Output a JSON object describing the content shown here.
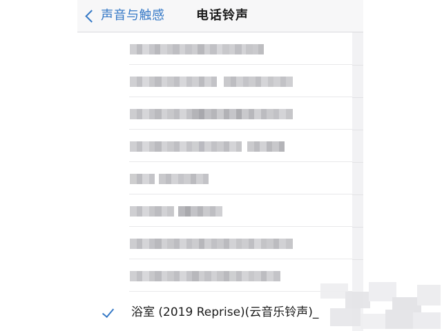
{
  "navbar": {
    "back_label": "声音与触感",
    "title": "电话铃声"
  },
  "list": {
    "rows": [
      {
        "label": "blurred-ringtone-1",
        "segments": [
          [
            "#cfcfd2",
            10
          ],
          [
            "#bdbdc1",
            8
          ],
          [
            "#d8d8db",
            10
          ],
          [
            "#c6c6ca",
            8
          ],
          [
            "#b9b9bd",
            8
          ],
          [
            "#d3d3d6",
            10
          ],
          [
            "#c9c9cc",
            8
          ],
          [
            "#bebec2",
            10
          ],
          [
            "#d2d2d5",
            8
          ],
          [
            "#c4c4c8",
            10
          ],
          [
            "#cdcdd0",
            8
          ],
          [
            "#b8b8bc",
            10
          ],
          [
            "#d0d0d3",
            8
          ],
          [
            "#c1c1c5",
            10
          ],
          [
            "#d6d6d9",
            8
          ],
          [
            "#c8c8cb",
            10
          ],
          [
            "#cfcfd2",
            8
          ],
          [
            "#bfbfc3",
            10
          ],
          [
            "#d3d3d6",
            6
          ],
          [
            "#c6c6c9",
            10
          ],
          [
            "#cacacd",
            8
          ],
          [
            "#bdbdc0",
            8
          ]
        ]
      },
      {
        "label": "blurred-ringtone-2",
        "segments": [
          [
            "#d0d0d3",
            10
          ],
          [
            "#c1c1c5",
            8
          ],
          [
            "#d9d9dc",
            10
          ],
          [
            "#c8c8cb",
            8
          ],
          [
            "#bcbcc0",
            10
          ],
          [
            "#d4d4d7",
            8
          ],
          [
            "#cacacd",
            10
          ],
          [
            "#c0c0c4",
            8
          ],
          [
            "#d7d7da",
            10
          ],
          [
            "#c5c5c9",
            8
          ],
          [
            "#cfcfd2",
            10
          ],
          [
            "#bbbbbf",
            8
          ],
          [
            "#d2d2d5",
            10
          ],
          [
            "#c3c3c7",
            8
          ],
          [
            "#ffffff",
            10
          ],
          [
            "#c9c9cc",
            10
          ],
          [
            "#bdbdc1",
            8
          ],
          [
            "#d1d1d4",
            10
          ],
          [
            "#c4c4c8",
            8
          ],
          [
            "#cccccf",
            10
          ],
          [
            "#bfbfc3",
            8
          ],
          [
            "#d5d5d8",
            10
          ],
          [
            "#c7c7ca",
            8
          ],
          [
            "#d0d0d3",
            10
          ],
          [
            "#c2c2c6",
            8
          ],
          [
            "#cfcfd2",
            10
          ]
        ]
      },
      {
        "label": "blurred-ringtone-3",
        "segments": [
          [
            "#cdcdd0",
            10
          ],
          [
            "#bfbfc3",
            8
          ],
          [
            "#d6d6d9",
            10
          ],
          [
            "#c5c5c9",
            8
          ],
          [
            "#bababe",
            10
          ],
          [
            "#d2d2d5",
            8
          ],
          [
            "#c8c8cb",
            10
          ],
          [
            "#bebec2",
            8
          ],
          [
            "#d5d5d8",
            10
          ],
          [
            "#c3c3c7",
            8
          ],
          [
            "#b4b4b8",
            10
          ],
          [
            "#a8a8ad",
            8
          ],
          [
            "#c0c0c4",
            10
          ],
          [
            "#b6b6ba",
            8
          ],
          [
            "#cbcbce",
            10
          ],
          [
            "#b2b2b6",
            8
          ],
          [
            "#c5c5c9",
            10
          ],
          [
            "#acacb0",
            8
          ],
          [
            "#c9c9cc",
            10
          ],
          [
            "#b8b8bc",
            8
          ],
          [
            "#d1d1d4",
            10
          ],
          [
            "#bcbcc0",
            8
          ],
          [
            "#cacacd",
            10
          ],
          [
            "#c2c2c6",
            8
          ],
          [
            "#d4d4d7",
            10
          ],
          [
            "#c6c6c9",
            10
          ]
        ]
      },
      {
        "label": "blurred-ringtone-4",
        "segments": [
          [
            "#cfcfd2",
            10
          ],
          [
            "#c0c0c4",
            8
          ],
          [
            "#d8d8db",
            10
          ],
          [
            "#c7c7ca",
            8
          ],
          [
            "#bbbbbf",
            10
          ],
          [
            "#d3d3d6",
            8
          ],
          [
            "#c9c9cc",
            10
          ],
          [
            "#bfbfc3",
            8
          ],
          [
            "#d6d6d9",
            10
          ],
          [
            "#c4c4c8",
            8
          ],
          [
            "#cecfd1",
            10
          ],
          [
            "#babac0",
            8
          ],
          [
            "#d1d1d4",
            10
          ],
          [
            "#c2c2c6",
            8
          ],
          [
            "#cbcbce",
            10
          ],
          [
            "#bdbdc1",
            8
          ],
          [
            "#d4d4d7",
            10
          ],
          [
            "#c6c6c9",
            8
          ],
          [
            "#ffffff",
            8
          ],
          [
            "#cacacd",
            10
          ],
          [
            "#bcbcc0",
            8
          ],
          [
            "#d2d2d5",
            10
          ],
          [
            "#b9b9bd",
            8
          ],
          [
            "#c8c8cb",
            10
          ],
          [
            "#b4b4b8",
            8
          ]
        ]
      },
      {
        "label": "blurred-ringtone-5",
        "segments": [
          [
            "#cececf",
            10
          ],
          [
            "#bdbdc1",
            8
          ],
          [
            "#d6d6d9",
            10
          ],
          [
            "#c4c4c8",
            8
          ],
          [
            "#ffffff",
            6
          ],
          [
            "#c9c9cc",
            10
          ],
          [
            "#bebec2",
            8
          ],
          [
            "#d3d3d6",
            10
          ],
          [
            "#c5c5c9",
            8
          ],
          [
            "#cdcdd0",
            10
          ],
          [
            "#bbbbbf",
            8
          ],
          [
            "#d0d0d3",
            10
          ],
          [
            "#c3c3c7",
            8
          ]
        ]
      },
      {
        "label": "blurred-ringtone-6",
        "segments": [
          [
            "#cfcfd2",
            10
          ],
          [
            "#c0c0c4",
            8
          ],
          [
            "#d7d7da",
            10
          ],
          [
            "#c6c6c9",
            8
          ],
          [
            "#bcbcc0",
            10
          ],
          [
            "#d2d2d5",
            8
          ],
          [
            "#c8c8cb",
            10
          ],
          [
            "#ffffff",
            6
          ],
          [
            "#b8b8bc",
            10
          ],
          [
            "#a9a9ad",
            8
          ],
          [
            "#c3c3c7",
            10
          ],
          [
            "#b5b5b9",
            8
          ],
          [
            "#cacacd",
            10
          ],
          [
            "#bebec2",
            8
          ],
          [
            "#d0d0d3",
            10
          ]
        ]
      },
      {
        "label": "blurred-ringtone-7",
        "segments": [
          [
            "#cdcdd0",
            10
          ],
          [
            "#bebec2",
            8
          ],
          [
            "#d5d5d8",
            10
          ],
          [
            "#c3c3c7",
            8
          ],
          [
            "#b9b9bd",
            10
          ],
          [
            "#d1d1d4",
            8
          ],
          [
            "#c7c7ca",
            10
          ],
          [
            "#bdbdc1",
            8
          ],
          [
            "#d4d4d7",
            10
          ],
          [
            "#c2c2c6",
            8
          ],
          [
            "#cccccf",
            10
          ],
          [
            "#b7b7bb",
            8
          ],
          [
            "#cfcfd2",
            10
          ],
          [
            "#c1c1c5",
            8
          ],
          [
            "#c9c9cc",
            10
          ],
          [
            "#bbbbbf",
            8
          ],
          [
            "#d2d2d5",
            10
          ],
          [
            "#c5c5c8",
            8
          ],
          [
            "#cdcdd0",
            10
          ],
          [
            "#bfbfc3",
            8
          ],
          [
            "#d6d6d9",
            10
          ],
          [
            "#c4c4c7",
            8
          ],
          [
            "#cacacd",
            10
          ],
          [
            "#bcbcc0",
            8
          ],
          [
            "#d1d1d4",
            10
          ],
          [
            "#c6c6c9",
            10
          ]
        ]
      },
      {
        "label": "blurred-ringtone-8",
        "segments": [
          [
            "#cfcfd2",
            10
          ],
          [
            "#c1c1c5",
            8
          ],
          [
            "#d8d8db",
            10
          ],
          [
            "#c7c7ca",
            8
          ],
          [
            "#bcbcc0",
            10
          ],
          [
            "#d3d3d6",
            8
          ],
          [
            "#c9c9cc",
            10
          ],
          [
            "#bfbfc3",
            8
          ],
          [
            "#d6d6d9",
            10
          ],
          [
            "#c5c5c9",
            8
          ],
          [
            "#b8b8bc",
            10
          ],
          [
            "#cdcdd0",
            8
          ],
          [
            "#c2c2c6",
            10
          ],
          [
            "#d1d1d4",
            8
          ],
          [
            "#c6c6c9",
            10
          ],
          [
            "#bababe",
            8
          ],
          [
            "#cecfd1",
            10
          ],
          [
            "#c0c0c4",
            8
          ],
          [
            "#d4d4d7",
            10
          ],
          [
            "#c8c8cb",
            8
          ],
          [
            "#cfcfd2",
            10
          ],
          [
            "#bdbdc1",
            8
          ],
          [
            "#d2d2d5",
            10
          ],
          [
            "#c4c4c8",
            10
          ]
        ]
      }
    ],
    "selected": {
      "name": "浴室 (2019 Reprise)(云音乐铃声)_"
    }
  },
  "colors": {
    "accent": "#3478c6",
    "navbar_bg": "#f7f7f8",
    "text": "#1a1a1a"
  },
  "icons": {
    "back": "chevron-left-icon",
    "selected": "checkmark-icon"
  }
}
